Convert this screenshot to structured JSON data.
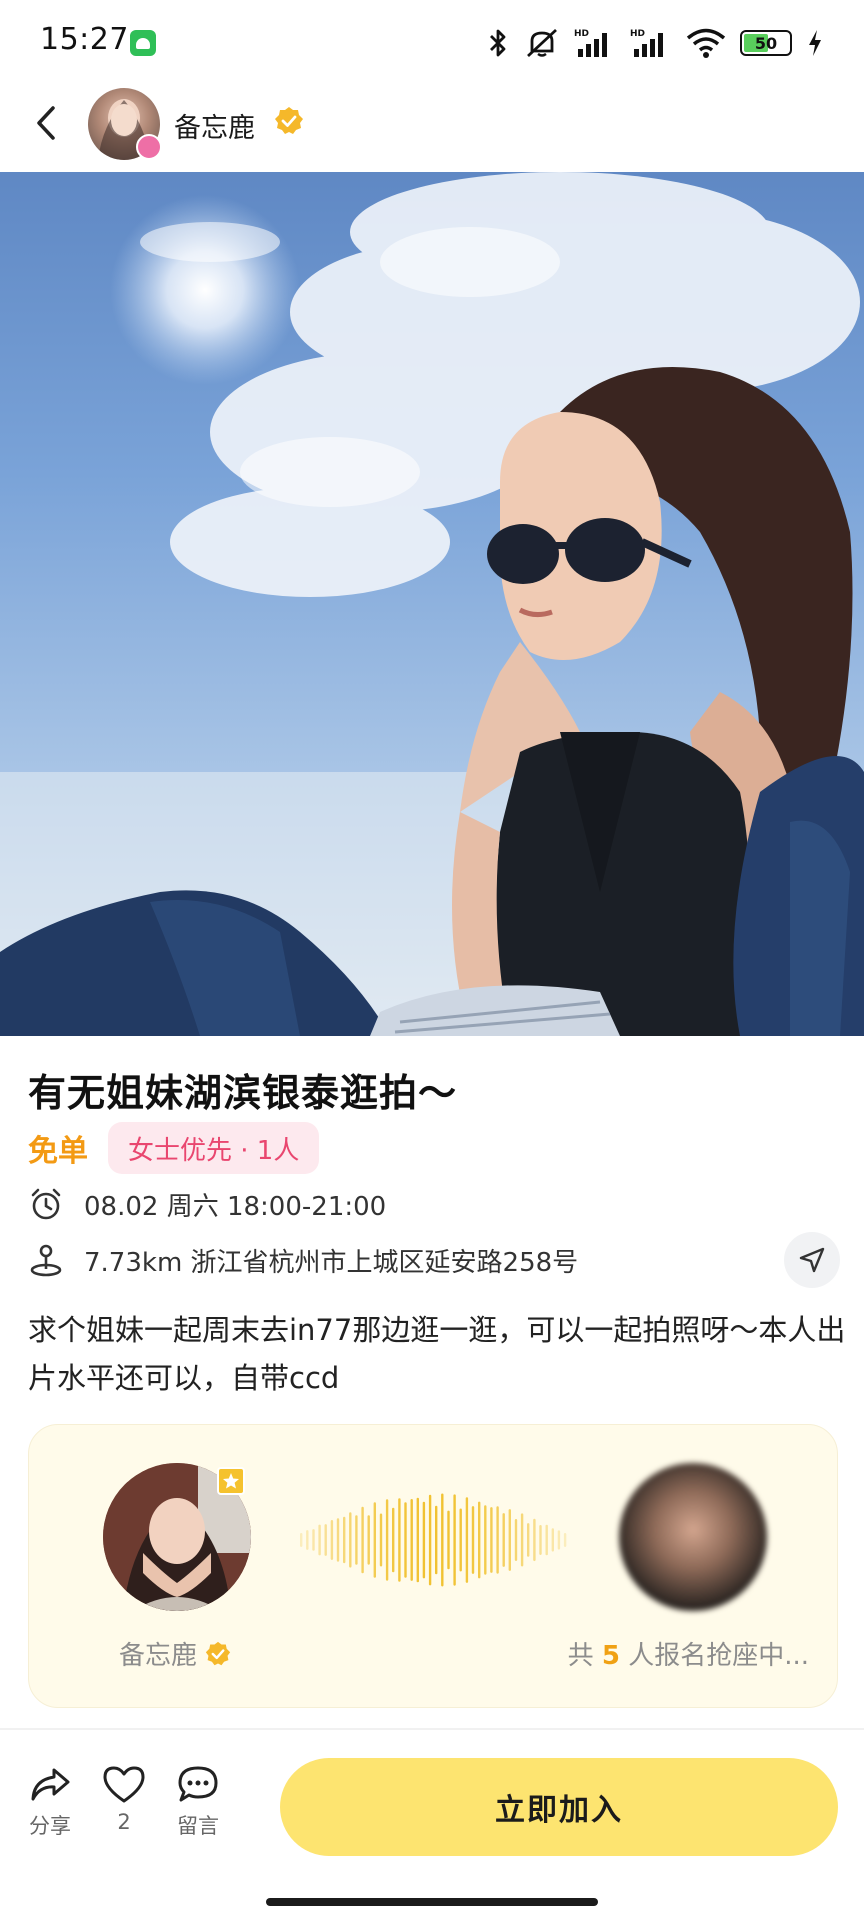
{
  "status_bar": {
    "time": "15:27",
    "battery": "50",
    "icons": [
      "android-icon",
      "bluetooth-icon",
      "mute-icon",
      "hd-signal-icon",
      "hd-signal-icon",
      "wifi-icon",
      "battery-icon",
      "charging-icon"
    ]
  },
  "header": {
    "author_name": "备忘鹿",
    "verified": true,
    "back_icon": "chevron-left-icon"
  },
  "post": {
    "title": "有无姐妹湖滨银泰逛拍～",
    "price_tag": "免单",
    "pref_tag": "女士优先 · 1人",
    "datetime": "08.02 周六 18:00-21:00",
    "location": "7.73km 浙江省杭州市上城区延安路258号",
    "description": "求个姐妹一起周末去in77那边逛一逛，可以一起拍照呀～本人出片水平还可以，自带ccd"
  },
  "participants": {
    "host_name": "备忘鹿",
    "signup_prefix": "共 ",
    "signup_count": "5",
    "signup_suffix": " 人报名抢座中..."
  },
  "bottom_bar": {
    "share_label": "分享",
    "like_count": "2",
    "comment_label": "留言",
    "join_label": "立即加入"
  },
  "colors": {
    "accent_yellow": "#fde470",
    "price_orange": "#f39a14",
    "pref_pink": "#e9466f",
    "pref_bg": "#fde9ee",
    "verify_gold": "#f5b82a",
    "card_bg": "#fffbea"
  }
}
